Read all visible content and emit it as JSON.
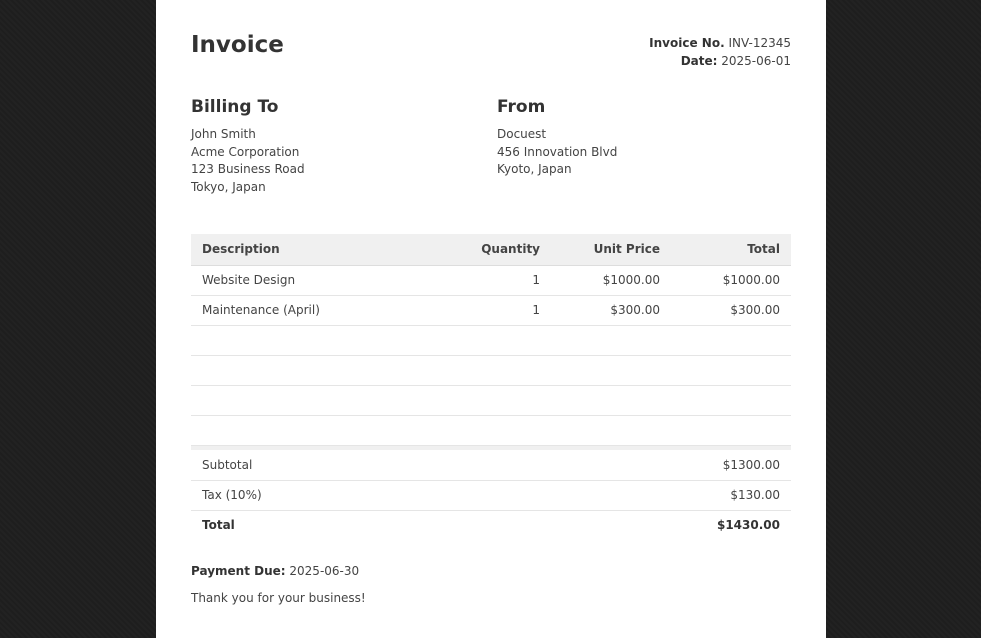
{
  "invoice": {
    "title": "Invoice",
    "number_label": "Invoice No.",
    "number": "INV-12345",
    "date_label": "Date:",
    "date": "2025-06-01"
  },
  "billing_to": {
    "heading": "Billing To",
    "lines": [
      "John Smith",
      "Acme Corporation",
      "123 Business Road",
      "Tokyo, Japan"
    ]
  },
  "from": {
    "heading": "From",
    "lines": [
      "Docuest",
      "456 Innovation Blvd",
      "Kyoto, Japan"
    ]
  },
  "items_table": {
    "headers": [
      "Description",
      "Quantity",
      "Unit Price",
      "Total"
    ],
    "rows": [
      [
        "Website Design",
        "1",
        "$1000.00",
        "$1000.00"
      ],
      [
        "Maintenance (April)",
        "1",
        "$300.00",
        "$300.00"
      ],
      [
        "",
        "",
        "",
        ""
      ],
      [
        "",
        "",
        "",
        ""
      ],
      [
        "",
        "",
        "",
        ""
      ],
      [
        "",
        "",
        "",
        ""
      ]
    ]
  },
  "summary": {
    "subtotal_label": "Subtotal",
    "subtotal": "$1300.00",
    "tax_label": "Tax (10%)",
    "tax": "$130.00",
    "total_label": "Total",
    "total": "$1430.00"
  },
  "footer": {
    "due_label": "Payment Due:",
    "due_date": "2025-06-30",
    "thanks": "Thank you for your business!"
  }
}
